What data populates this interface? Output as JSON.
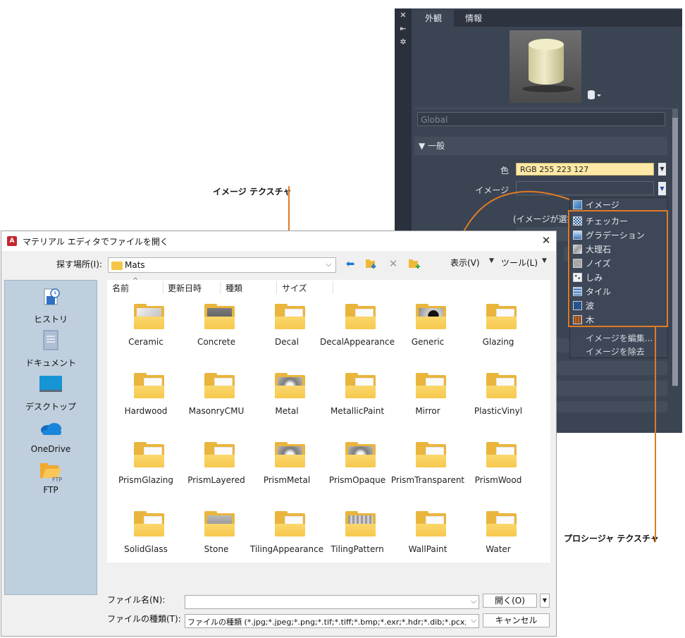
{
  "callouts": {
    "image_texture": "イメージ テクスチャ",
    "procedural_texture": "プロシージャ テクスチャ"
  },
  "material_editor": {
    "tabs": [
      "外観",
      "情報"
    ],
    "strip_icons": [
      "close-icon",
      "auto-hide-icon",
      "settings-icon"
    ],
    "name_field": "Global",
    "section_general": "▼ 一般",
    "color_label": "色",
    "color_value": "RGB 255 223 127",
    "image_label": "イメージ",
    "partial_row_text": "(イメージが選択さ"
  },
  "image_dropdown": {
    "items": [
      {
        "label": "イメージ",
        "icon": "image-texture-icon"
      },
      {
        "label": "チェッカー",
        "icon": "checker-texture-icon"
      },
      {
        "label": "グラデーション",
        "icon": "gradient-texture-icon"
      },
      {
        "label": "大理石",
        "icon": "marble-texture-icon"
      },
      {
        "label": "ノイズ",
        "icon": "noise-texture-icon"
      },
      {
        "label": "しみ",
        "icon": "speckle-texture-icon"
      },
      {
        "label": "タイル",
        "icon": "tiles-texture-icon"
      },
      {
        "label": "波",
        "icon": "waves-texture-icon"
      },
      {
        "label": "木",
        "icon": "wood-texture-icon"
      }
    ],
    "edit_image": "イメージを編集...",
    "remove_image": "イメージを除去"
  },
  "dialog": {
    "title": "マテリアル エディタでファイルを開く",
    "look_in_label": "探す場所(I):",
    "look_in_value": "Mats",
    "view_label": "表示(V)",
    "tools_label": "ツール(L)",
    "places": [
      "ヒストリ",
      "ドキュメント",
      "デスクトップ",
      "OneDrive",
      "FTP"
    ],
    "columns": [
      "名前",
      "更新日時",
      "種類",
      "サイズ"
    ],
    "folders": [
      "Ceramic",
      "Concrete",
      "Decal",
      "DecalAppearance",
      "Generic",
      "Glazing",
      "Hardwood",
      "MasonryCMU",
      "Metal",
      "MetallicPaint",
      "Mirror",
      "PlasticVinyl",
      "PrismGlazing",
      "PrismLayered",
      "PrismMetal",
      "PrismOpaque",
      "PrismTransparent",
      "PrismWood",
      "SolidGlass",
      "Stone",
      "TilingAppearance",
      "TilingPattern",
      "WallPaint",
      "Water"
    ],
    "filename_label": "ファイル名(N):",
    "filename_value": "",
    "filetype_label": "ファイルの種類(T):",
    "filetype_value": "ファイルの種類 (*.jpg;*.jpeg;*.png;*.tif;*.tiff;*.bmp;*.exr;*.hdr;*.dib;*.pcx;*.gif;*.tga;*",
    "open_button": "開く(O)",
    "cancel_button": "キャンセル"
  },
  "colors": {
    "callout": "#e07b24",
    "panel_bg": "#3b4453",
    "color_swatch": "#fde9a5",
    "folder": "#f6c84d"
  }
}
